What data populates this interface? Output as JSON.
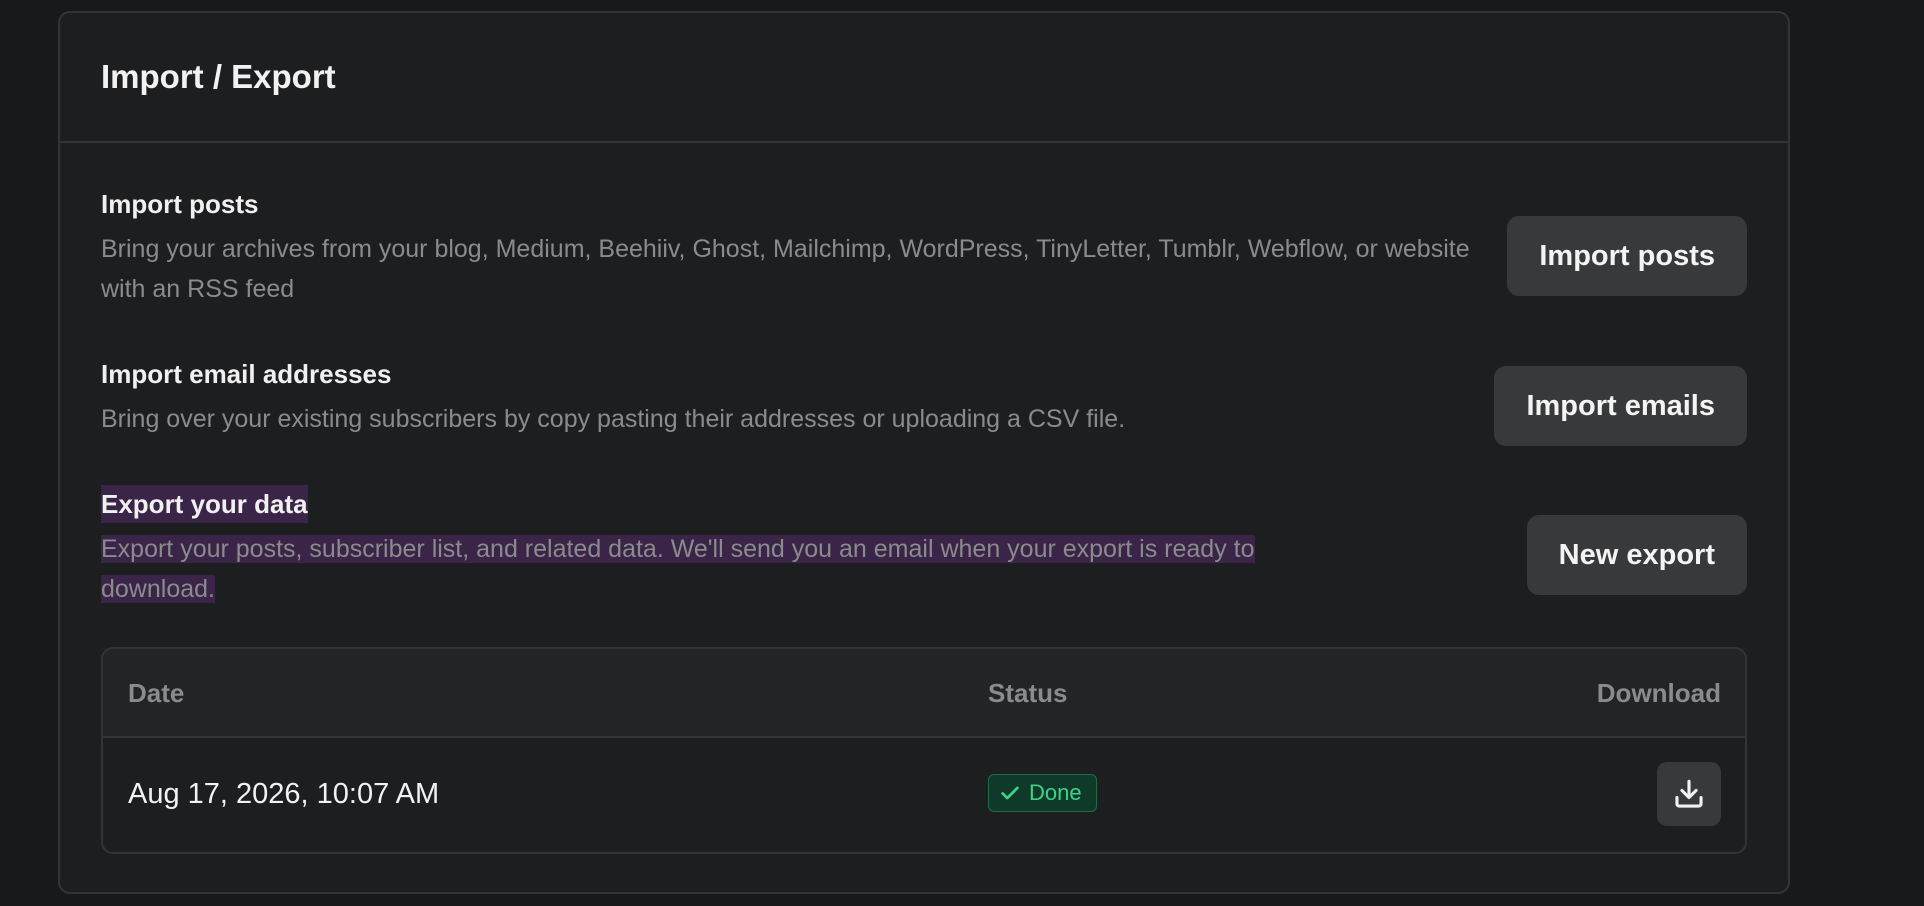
{
  "card": {
    "title": "Import / Export"
  },
  "sections": {
    "import_posts": {
      "title": "Import posts",
      "description": "Bring your archives from your blog, Medium, Beehiiv, Ghost, Mailchimp, WordPress, TinyLetter, Tumblr, Webflow, or website with an RSS feed",
      "button_label": "Import posts"
    },
    "import_emails": {
      "title": "Import email addresses",
      "description": "Bring over your existing subscribers by copy pasting their addresses or uploading a CSV file.",
      "button_label": "Import emails"
    },
    "export_data": {
      "title": "Export your data",
      "description": "Export your posts, subscriber list, and related data. We'll send you an email when your export is ready to download.",
      "button_label": "New export"
    }
  },
  "exports_table": {
    "headers": {
      "date": "Date",
      "status": "Status",
      "download": "Download"
    },
    "rows": [
      {
        "date": "Aug 17, 2026, 10:07 AM",
        "status": "Done",
        "download_icon": "download-icon"
      }
    ]
  },
  "colors": {
    "background": "#18191b",
    "card": "#1d1e20",
    "button": "#38393b",
    "highlight": "#3a2447",
    "status_done_text": "#3ed18a",
    "status_done_bg": "#0f3a29"
  }
}
